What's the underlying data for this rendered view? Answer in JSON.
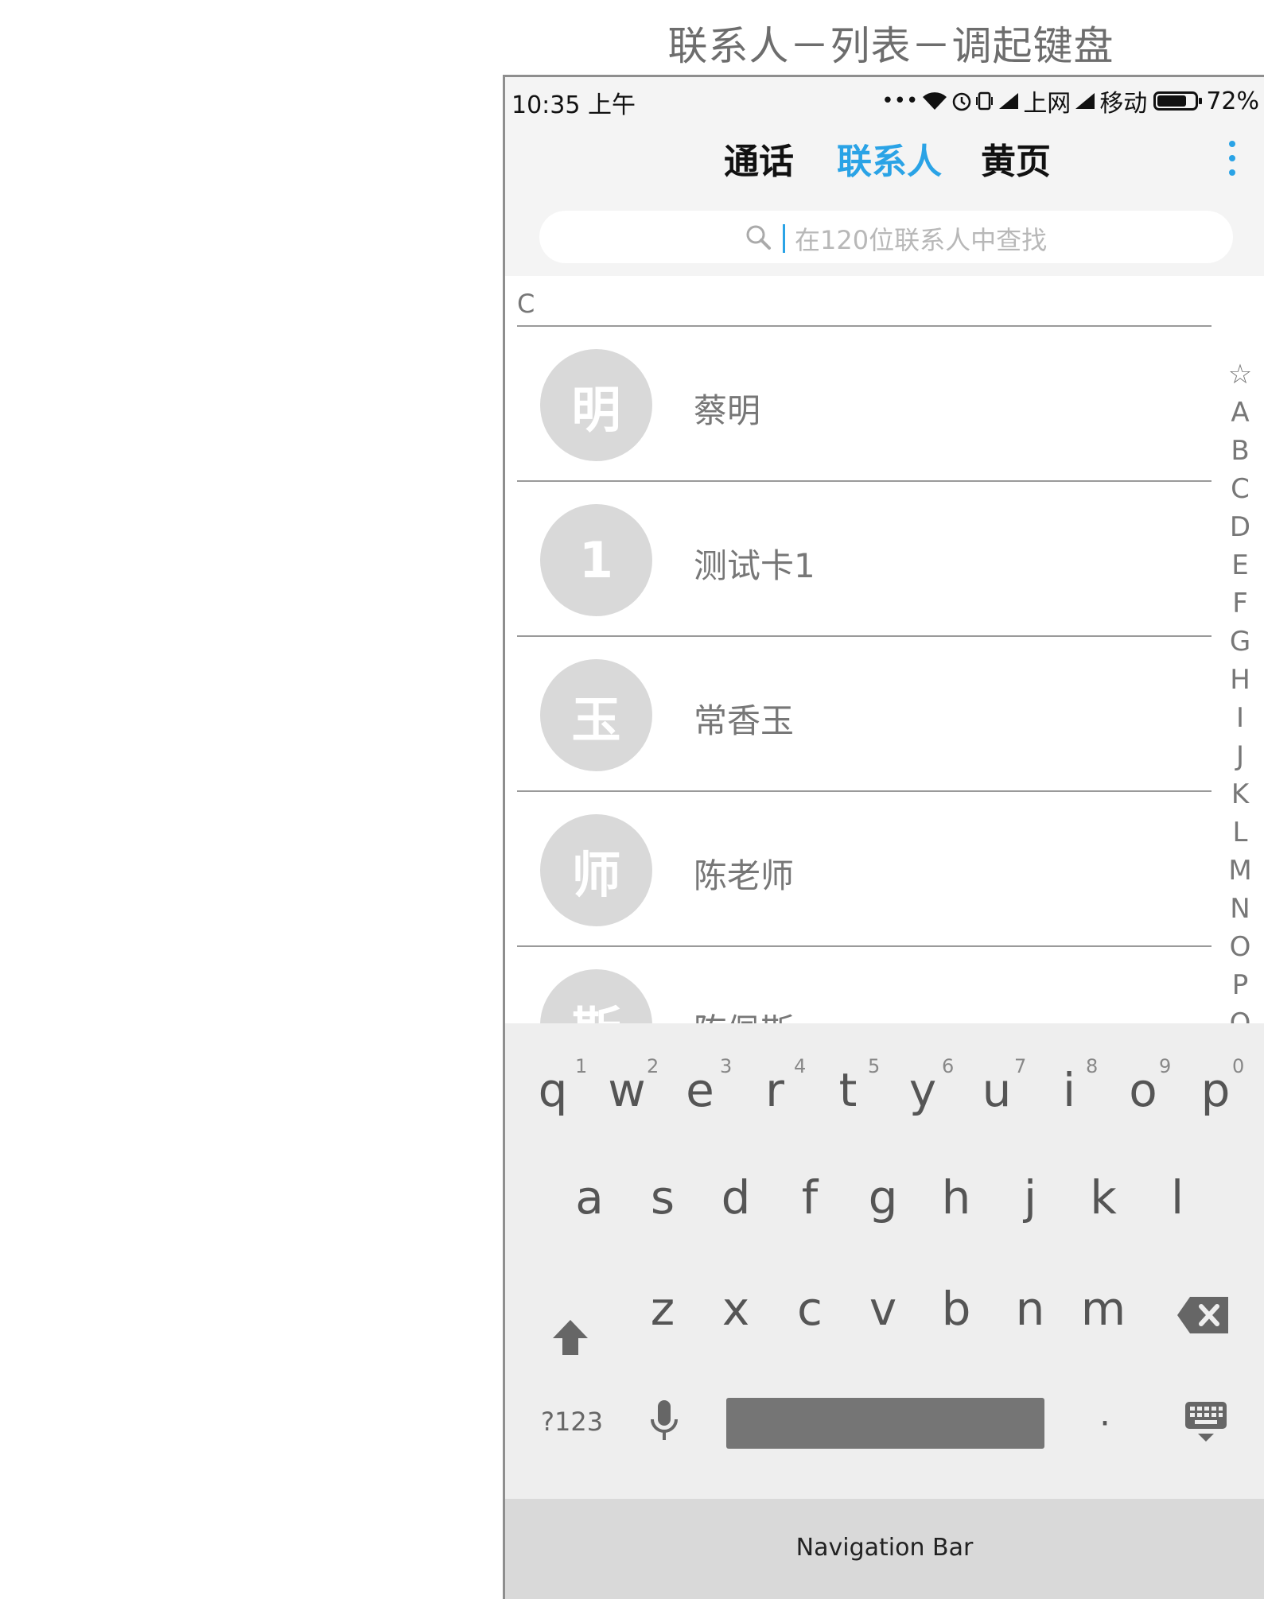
{
  "page_title": "联系人－列表－调起键盘",
  "status_bar": {
    "time": "10:35 上午",
    "dots": "•••",
    "net1_label": "上网",
    "net2_label": "移动",
    "battery": "72%"
  },
  "tabs": [
    {
      "label": "通话",
      "active": false
    },
    {
      "label": "联系人",
      "active": true
    },
    {
      "label": "黄页",
      "active": false
    }
  ],
  "accent_color": "#2aa3e6",
  "search": {
    "placeholder": "在120位联系人中查找"
  },
  "section_header": "C",
  "contacts": [
    {
      "avatar": "明",
      "name": "蔡明"
    },
    {
      "avatar": "1",
      "name": "测试卡1"
    },
    {
      "avatar": "玉",
      "name": "常香玉"
    },
    {
      "avatar": "师",
      "name": "陈老师"
    },
    {
      "avatar": "斯",
      "name": "陈佩斯"
    }
  ],
  "index_letters": [
    "☆",
    "A",
    "B",
    "C",
    "D",
    "E",
    "F",
    "G",
    "H",
    "I",
    "J",
    "K",
    "L",
    "M",
    "N",
    "O",
    "P",
    "Q"
  ],
  "keyboard": {
    "row1": [
      "q",
      "w",
      "e",
      "r",
      "t",
      "y",
      "u",
      "i",
      "o",
      "p"
    ],
    "row1_hints": [
      "1",
      "2",
      "3",
      "4",
      "5",
      "6",
      "7",
      "8",
      "9",
      "0"
    ],
    "row2": [
      "a",
      "s",
      "d",
      "f",
      "g",
      "h",
      "j",
      "k",
      "l"
    ],
    "row3": [
      "z",
      "x",
      "c",
      "v",
      "b",
      "n",
      "m"
    ],
    "symbols_key": "?123",
    "period_key": "·"
  },
  "nav_bar": {
    "label": "Navigation Bar"
  }
}
